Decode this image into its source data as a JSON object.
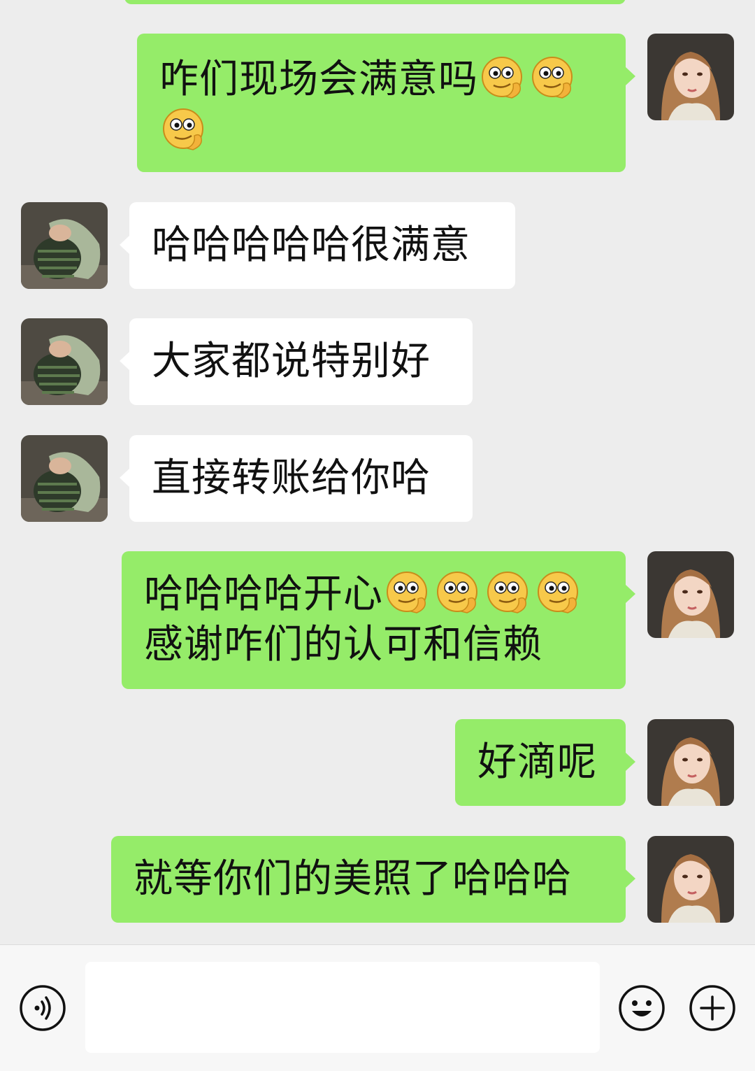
{
  "messages": [
    {
      "side": "right",
      "text": "咋们现场会满意吗",
      "emojis": 3,
      "text2": ""
    },
    {
      "side": "left",
      "text": "哈哈哈哈哈很满意"
    },
    {
      "side": "left",
      "text": "大家都说特别好"
    },
    {
      "side": "left",
      "text": "直接转账给你哈"
    },
    {
      "side": "right",
      "text": "哈哈哈哈开心",
      "emojis": 4,
      "text2": "感谢咋们的认可和信赖"
    },
    {
      "side": "right",
      "text": "好滴呢"
    },
    {
      "side": "right",
      "text": "就等你们的美照了哈哈哈"
    }
  ],
  "emoji_name": "thinking-face-emoji",
  "colors": {
    "sent_bubble": "#95ec69",
    "received_bubble": "#ffffff",
    "background": "#ededed"
  },
  "input": {
    "placeholder": ""
  },
  "icons": {
    "voice": "voice-icon",
    "emoji": "emoji-face-icon",
    "more": "plus-icon"
  }
}
